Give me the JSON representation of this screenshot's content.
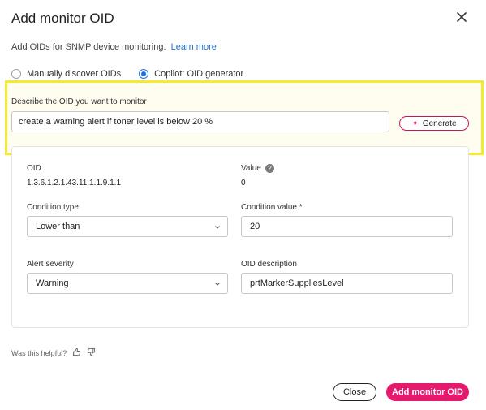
{
  "dialog": {
    "title": "Add monitor OID",
    "intro_text": "Add OIDs for SNMP device monitoring.",
    "learn_more": "Learn more"
  },
  "mode": {
    "options": [
      {
        "label": "Manually discover OIDs",
        "selected": false
      },
      {
        "label": "Copilot: OID generator",
        "selected": true
      }
    ]
  },
  "generator": {
    "label": "Describe the OID you want to monitor",
    "input_value": "create a warning alert if toner level is below 20 %",
    "button_label": "Generate"
  },
  "result": {
    "oid_label": "OID",
    "oid_value": "1.3.6.1.2.1.43.11.1.1.9.1.1",
    "value_label": "Value",
    "value_value": "0",
    "condition_type_label": "Condition type",
    "condition_type_value": "Lower than",
    "condition_value_label": "Condition value *",
    "condition_value_value": "20",
    "severity_label": "Alert severity",
    "severity_value": "Warning",
    "description_label": "OID description",
    "description_value": "prtMarkerSuppliesLevel"
  },
  "feedback": {
    "question": "Was this helpful?"
  },
  "footer": {
    "close_label": "Close",
    "add_label": "Add monitor OID"
  },
  "colors": {
    "accent_pink": "#e5196e",
    "radio_blue": "#1a73e8",
    "highlight_yellow": "#f5ea2e",
    "link_blue": "#1f6fd1"
  }
}
